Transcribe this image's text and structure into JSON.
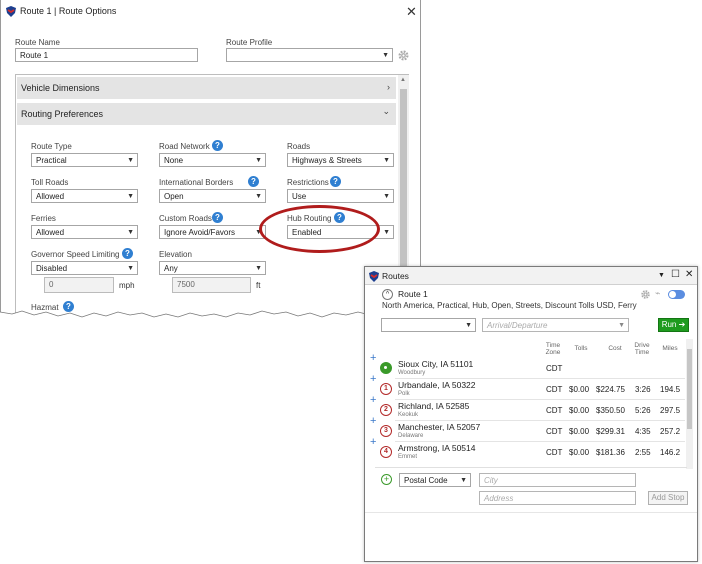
{
  "route_options": {
    "title": "Route 1 | Route Options",
    "route_name_label": "Route Name",
    "route_name_value": "Route 1",
    "route_profile_label": "Route Profile",
    "route_profile_value": "",
    "sections": {
      "vehicle_dimensions": "Vehicle Dimensions",
      "routing_preferences": "Routing Preferences"
    },
    "fields": {
      "route_type": {
        "label": "Route Type",
        "value": "Practical"
      },
      "road_network": {
        "label": "Road Network",
        "value": "None"
      },
      "roads": {
        "label": "Roads",
        "value": "Highways & Streets"
      },
      "toll_roads": {
        "label": "Toll Roads",
        "value": "Allowed"
      },
      "international_borders": {
        "label": "International Borders",
        "value": "Open"
      },
      "restrictions": {
        "label": "Restrictions",
        "value": "Use"
      },
      "ferries": {
        "label": "Ferries",
        "value": "Allowed"
      },
      "custom_roads": {
        "label": "Custom Roads",
        "value": "Ignore Avoid/Favors"
      },
      "hub_routing": {
        "label": "Hub Routing",
        "value": "Enabled"
      },
      "governor_speed_limiting": {
        "label": "Governor Speed Limiting",
        "value": "Disabled",
        "number": "0",
        "unit": "mph"
      },
      "elevation": {
        "label": "Elevation",
        "value": "Any",
        "number": "7500",
        "unit": "ft"
      },
      "hazmat": {
        "label": "Hazmat"
      }
    }
  },
  "routes_panel": {
    "title": "Routes",
    "route_name": "Route 1",
    "summary": "North America, Practical, Hub, Open, Streets, Discount Tolls USD, Ferry",
    "route_select_value": "",
    "arrival_placeholder": "Arrival/Departure",
    "run_label": "Run",
    "columns": {
      "time_zone": "Time Zone",
      "tolls": "Tolls",
      "cost": "Cost",
      "drive_time": "Drive Time",
      "miles": "Miles"
    },
    "stops": [
      {
        "marker": "",
        "city": "Sioux City, IA 51101",
        "county": "Woodbury",
        "tz": "CDT",
        "tolls": "",
        "cost": "",
        "time": "",
        "miles": ""
      },
      {
        "marker": "1",
        "city": "Urbandale, IA 50322",
        "county": "Polk",
        "tz": "CDT",
        "tolls": "$0.00",
        "cost": "$224.75",
        "time": "3:26",
        "miles": "194.5"
      },
      {
        "marker": "2",
        "city": "Richland, IA 52585",
        "county": "Keokuk",
        "tz": "CDT",
        "tolls": "$0.00",
        "cost": "$350.50",
        "time": "5:26",
        "miles": "297.5"
      },
      {
        "marker": "3",
        "city": "Manchester, IA 52057",
        "county": "Delaware",
        "tz": "CDT",
        "tolls": "$0.00",
        "cost": "$299.31",
        "time": "4:35",
        "miles": "257.2"
      },
      {
        "marker": "4",
        "city": "Armstrong, IA 50514",
        "county": "Emmet",
        "tz": "CDT",
        "tolls": "$0.00",
        "cost": "$181.36",
        "time": "2:55",
        "miles": "146.2"
      }
    ],
    "add_stop": {
      "search_type": "Postal Code",
      "city_placeholder": "City",
      "address_placeholder": "Address",
      "button": "Add Stop"
    }
  },
  "icons": {
    "app_logo": "shield-logo-icon",
    "help": "help-icon",
    "gear": "gear-icon",
    "close": "close-icon"
  },
  "colors": {
    "annotation": "#b01c1c",
    "help": "#2f7fd1",
    "run": "#1e9b1e",
    "stop_marker": "#b32a2a",
    "origin_marker": "#3a9a2a"
  }
}
